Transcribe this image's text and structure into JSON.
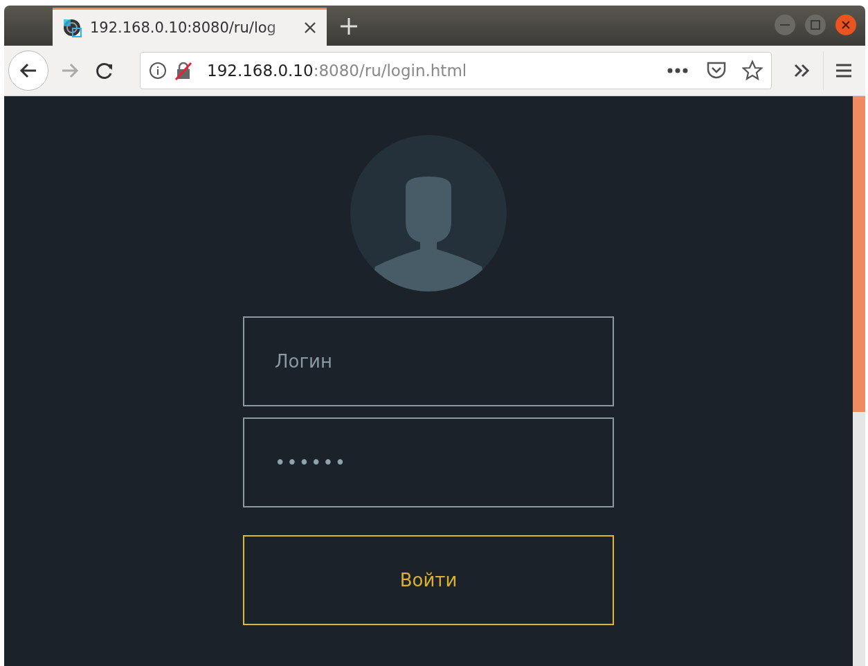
{
  "tab": {
    "title": "192.168.0.10:8080/ru/log",
    "selected": true
  },
  "address_bar": {
    "host": "192.168.0.10",
    "path": ":8080/ru/login.html"
  },
  "login_form": {
    "login_placeholder": "Логин",
    "password_value": "••••••",
    "submit_label": "Войти"
  }
}
